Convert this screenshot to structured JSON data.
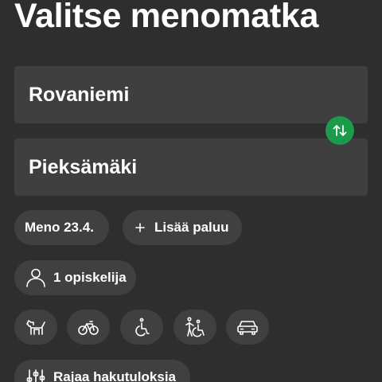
{
  "header": {
    "title": "Valitse menomatka"
  },
  "route": {
    "origin": "Rovaniemi",
    "destination": "Pieksämäki",
    "swap_icon": "swap-vertical-arrows-icon",
    "swap_color": "#1c9b4a"
  },
  "trip": {
    "departure_label": "Meno 23.4.",
    "add_return_label": "Lisää paluu",
    "add_return_icon": "plus-icon"
  },
  "passengers": {
    "label": "1 opiskelija",
    "icon": "person-icon"
  },
  "services": [
    {
      "name": "pet",
      "icon": "dog-icon"
    },
    {
      "name": "bicycle",
      "icon": "bicycle-icon"
    },
    {
      "name": "wheelchair",
      "icon": "wheelchair-icon"
    },
    {
      "name": "assistance",
      "icon": "assisted-person-icon"
    },
    {
      "name": "car",
      "icon": "car-icon"
    }
  ],
  "filters": {
    "label": "Rajaa hakutuloksia",
    "icon": "sliders-icon"
  },
  "colors": {
    "background": "#2e2e2e",
    "surface": "#3f3f3f",
    "accent": "#1c9b4a",
    "text": "#ffffff"
  }
}
